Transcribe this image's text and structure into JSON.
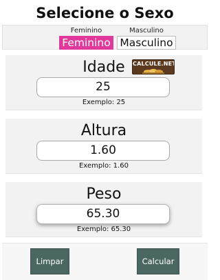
{
  "page": {
    "title": "Selecione o Sexo"
  },
  "sex": {
    "female_caption": "Feminino",
    "female_button": "Feminino",
    "male_caption": "Masculino",
    "male_button": "Masculino",
    "selected": "Feminino",
    "selected_color": "#e0399b"
  },
  "logo": {
    "text": "CALCULE.NET"
  },
  "fields": {
    "age": {
      "label": "Idade",
      "value": "25",
      "hint": "Exemplo: 25"
    },
    "height": {
      "label": "Altura",
      "value": "1.60",
      "hint": "Exemplo: 1.60"
    },
    "weight": {
      "label": "Peso",
      "value": "65.30",
      "hint": "Exemplo: 65.30"
    }
  },
  "actions": {
    "clear_label": "Limpar",
    "calculate_label": "Calcular",
    "button_color": "#4b6762"
  }
}
